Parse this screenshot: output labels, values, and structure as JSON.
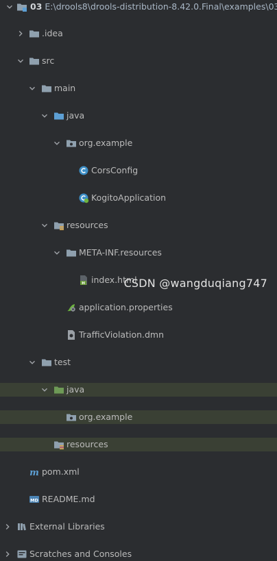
{
  "tree": {
    "root": {
      "name": "03",
      "path": "E:\\drools8\\drools-distribution-8.42.0.Final\\examples\\03"
    },
    "idea": "idea",
    "idea_prefix": ".",
    "src": "src",
    "main": "main",
    "java": "java",
    "org_example": "org.example",
    "cors_config": "CorsConfig",
    "kogito_application": "KogitoApplication",
    "resources": "resources",
    "meta_inf": "META-INF.resources",
    "index_html": "index.html",
    "app_properties": "application.properties",
    "traffic_dmn": "TrafficViolation.dmn",
    "test": "test",
    "test_java": "java",
    "test_org_example": "org.example",
    "test_resources": "resources",
    "pom": "pom.xml",
    "readme": "README.md",
    "external_libraries": "External Libraries",
    "scratches": "Scratches and Consoles"
  },
  "watermark": "CSDN @wangduqiang747",
  "colors": {
    "background": "#2b2d30",
    "highlight": "#3a4034",
    "folder": "#8fa0ae",
    "source_folder": "#5d9fd4",
    "test_folder": "#6e9a56",
    "text": "#bbbbbb"
  }
}
